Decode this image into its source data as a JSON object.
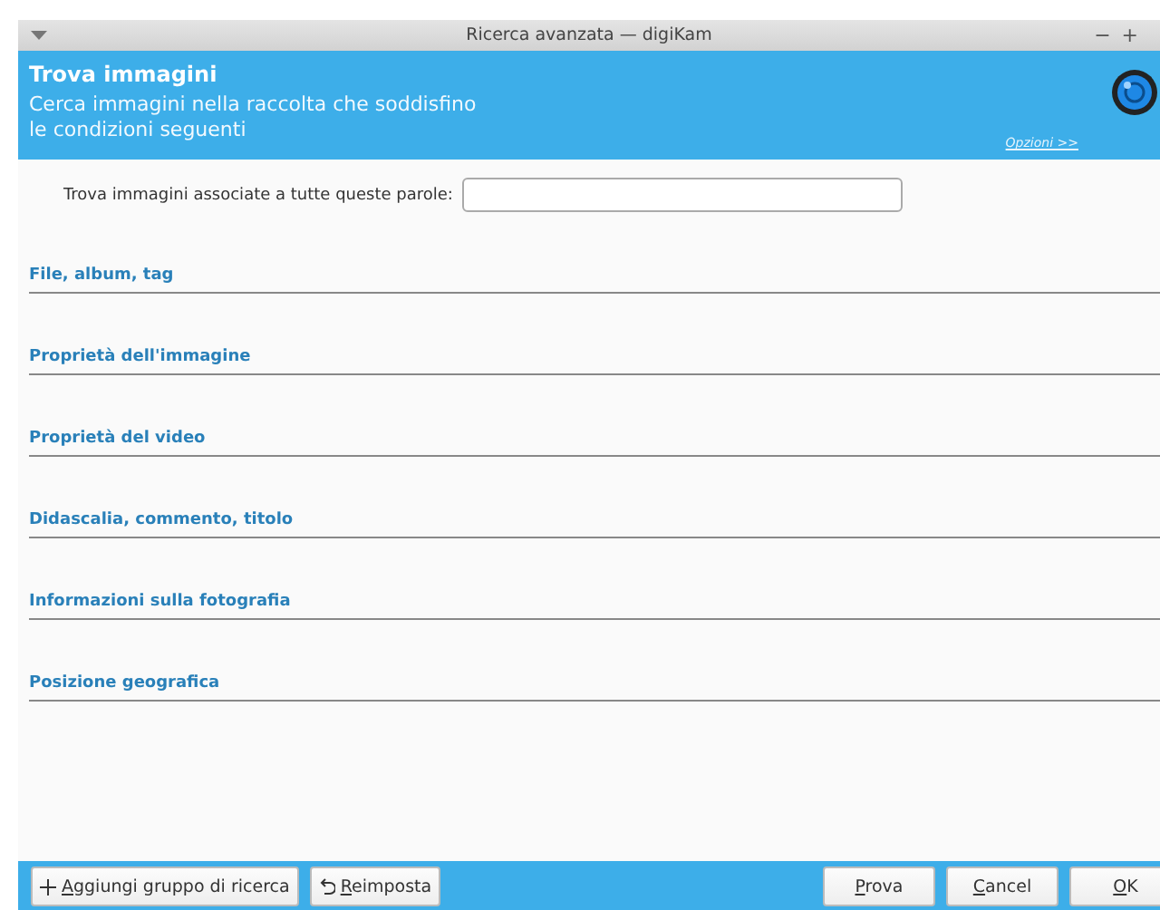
{
  "window": {
    "title": "Ricerca avanzata — digiKam",
    "controls": [
      "−",
      "+"
    ]
  },
  "header": {
    "title": "Trova immagini",
    "subtitle_lines": [
      "Cerca immagini nella raccolta che soddisfino",
      "le condizioni seguenti"
    ],
    "options_link": "Opzioni >>"
  },
  "keywords": {
    "label": "Trova immagini associate a tutte queste parole:"
  },
  "sections": [
    "File, album, tag",
    "Proprietà dell'immagine",
    "Proprietà del video",
    "Didascalia, commento, titolo",
    "Informazioni sulla fotografia",
    "Posizione geografica"
  ],
  "left_buttons": [
    {
      "kind": "add",
      "accel": "A",
      "rest": "ggiungi gruppo di ricerca"
    },
    {
      "kind": "reset",
      "accel": "R",
      "rest": "eimposta"
    }
  ],
  "right_buttons": [
    {
      "accel": "P",
      "rest": "rova"
    },
    {
      "accel": "C",
      "rest": "ancel"
    },
    {
      "accel": "O",
      "rest": "K"
    }
  ]
}
